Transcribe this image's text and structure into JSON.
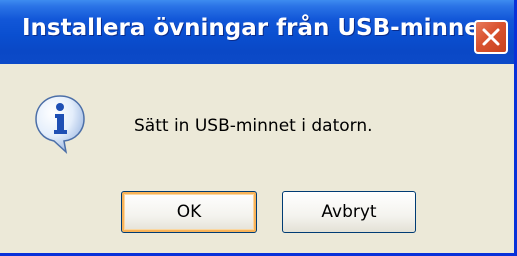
{
  "dialog": {
    "title": "Installera övningar från USB-minne",
    "message": "Sätt in USB-minnet i datorn.",
    "icon": "info-icon",
    "buttons": {
      "ok_label": "OK",
      "cancel_label": "Avbryt"
    }
  },
  "colors": {
    "titlebar_blue": "#0A4FD0",
    "close_red": "#D9532F",
    "dialog_bg": "#ECE9D8",
    "default_button_focus": "#F8B359"
  }
}
